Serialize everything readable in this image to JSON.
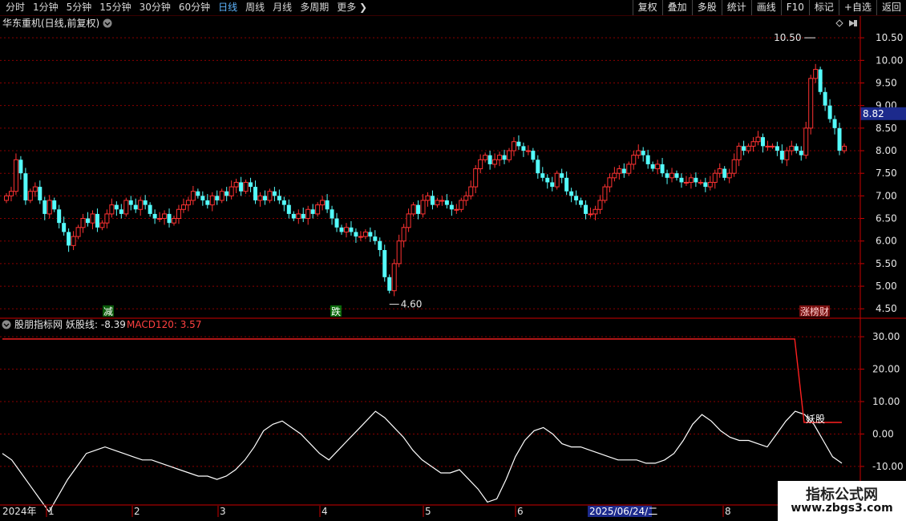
{
  "toolbar": {
    "periods": [
      "分时",
      "1分钟",
      "5分钟",
      "15分钟",
      "30分钟",
      "60分钟",
      "日线",
      "周线",
      "月线",
      "多周期",
      "更多"
    ],
    "active_period": "日线",
    "right_buttons": [
      "复权",
      "叠加",
      "多股",
      "统计",
      "画线",
      "F10",
      "标记",
      "+自选",
      "返回"
    ]
  },
  "colors": {
    "up": "#ff3232",
    "down": "#54fcfc",
    "bg": "#000000",
    "grid": "#8a0000",
    "axis": "#cc0000",
    "price_tag_bg": "#1c2a8c"
  },
  "main": {
    "title": "华东重机(日线,前复权)",
    "price_tag": "8.82",
    "high_label": "10.50",
    "low_label": "4.60",
    "markers": [
      "减",
      "跌",
      "涨榜财"
    ]
  },
  "indicator": {
    "title": "股朋指标网",
    "line1_label": "妖股线: -8.39",
    "line2_label": "MACD120: 3.57",
    "annotation": "妖股"
  },
  "xaxis": {
    "year_label": "2024年",
    "months": [
      "1",
      "2",
      "3",
      "4",
      "5",
      "6",
      "8"
    ],
    "highlight": "2025/06/24/二"
  },
  "watermark": {
    "line1": "指标公式网",
    "line2": "www.zbgs3.com"
  },
  "chart_data": [
    {
      "type": "candlestick",
      "title": "华东重机(日线,前复权)",
      "y_ticks": [
        4.5,
        5.0,
        5.5,
        6.0,
        6.5,
        7.0,
        7.5,
        8.0,
        8.5,
        9.0,
        9.5,
        10.0,
        10.5
      ],
      "ylim": [
        4.38,
        10.68
      ],
      "current_price": 8.82,
      "annotations": [
        {
          "label": "10.50",
          "value": 10.5
        },
        {
          "label": "4.60",
          "value": 4.6
        }
      ],
      "close": [
        7.0,
        7.1,
        7.8,
        7.5,
        6.9,
        7.1,
        7.2,
        6.9,
        6.6,
        6.9,
        6.7,
        6.4,
        6.2,
        5.9,
        6.1,
        6.3,
        6.5,
        6.4,
        6.6,
        6.3,
        6.4,
        6.6,
        6.8,
        6.7,
        6.6,
        6.9,
        6.8,
        6.7,
        6.9,
        6.8,
        6.6,
        6.5,
        6.5,
        6.6,
        6.4,
        6.5,
        6.7,
        6.8,
        6.9,
        7.1,
        7.0,
        6.9,
        6.8,
        7.0,
        6.9,
        7.1,
        7.0,
        7.2,
        7.3,
        7.1,
        7.3,
        7.2,
        6.9,
        7.0,
        6.9,
        7.1,
        7.0,
        6.9,
        6.8,
        6.6,
        6.5,
        6.6,
        6.5,
        6.7,
        6.6,
        6.8,
        6.9,
        6.7,
        6.5,
        6.3,
        6.2,
        6.3,
        6.2,
        6.1,
        6.1,
        6.2,
        6.1,
        6.0,
        5.8,
        5.2,
        4.9,
        5.5,
        6.0,
        6.3,
        6.6,
        6.8,
        6.6,
        6.9,
        7.0,
        6.8,
        6.9,
        6.9,
        6.8,
        6.7,
        6.7,
        6.9,
        7.0,
        7.2,
        7.6,
        7.8,
        7.9,
        7.7,
        7.8,
        7.9,
        7.8,
        8.0,
        8.2,
        8.1,
        8.0,
        8.0,
        7.8,
        7.5,
        7.4,
        7.3,
        7.2,
        7.5,
        7.4,
        7.1,
        7.0,
        6.9,
        6.8,
        6.6,
        6.6,
        6.7,
        6.9,
        7.2,
        7.4,
        7.5,
        7.6,
        7.5,
        7.7,
        7.9,
        8.0,
        7.9,
        7.7,
        7.6,
        7.7,
        7.5,
        7.4,
        7.5,
        7.4,
        7.3,
        7.3,
        7.4,
        7.3,
        7.3,
        7.2,
        7.3,
        7.5,
        7.6,
        7.4,
        7.5,
        7.8,
        8.1,
        8.0,
        8.1,
        8.2,
        8.3,
        8.1,
        8.1,
        8.1,
        8.0,
        7.8,
        8.0,
        8.1,
        8.0,
        7.9,
        8.5,
        9.6,
        9.8,
        9.3,
        9.0,
        8.7,
        8.5,
        8.0,
        8.1
      ],
      "xlabel": "",
      "ylabel": ""
    },
    {
      "type": "line",
      "series": [
        {
          "name": "妖股线",
          "values": [
            -6,
            -8,
            -12,
            -16,
            -20,
            -24,
            -19,
            -14,
            -10,
            -6,
            -5,
            -4,
            -5,
            -6,
            -7,
            -8,
            -8,
            -9,
            -10,
            -11,
            -12,
            -13,
            -13,
            -14,
            -13,
            -11,
            -8,
            -4,
            1,
            3,
            4,
            2,
            0,
            -3,
            -6,
            -8,
            -5,
            -2,
            1,
            4,
            7,
            5,
            2,
            -1,
            -5,
            -8,
            -10,
            -12,
            -12,
            -11,
            -14,
            -17,
            -21,
            -20,
            -14,
            -7,
            -2,
            1,
            2,
            0,
            -3,
            -4,
            -4,
            -5,
            -6,
            -7,
            -8,
            -8,
            -8,
            -9,
            -9,
            -8,
            -6,
            -2,
            3,
            6,
            4,
            1,
            -1,
            -2,
            -2,
            -3,
            -4,
            0,
            4,
            7,
            6,
            3,
            -2,
            -7,
            -9
          ],
          "ylim": [
            -12,
            32
          ]
        },
        {
          "name": "MACD120",
          "values": [
            29.3,
            29.3,
            29.3,
            29.3,
            29.3,
            29.3,
            29.3,
            29.3,
            29.3,
            29.3,
            29.3,
            29.3,
            29.3,
            29.3,
            29.3,
            29.3,
            29.3,
            29.3,
            29.3,
            29.3,
            29.3,
            29.3,
            29.3,
            29.3,
            29.3,
            29.3,
            29.3,
            29.3,
            29.3,
            29.3,
            29.3,
            29.3,
            29.3,
            29.3,
            29.3,
            29.3,
            29.3,
            29.3,
            29.3,
            29.3,
            29.3,
            29.3,
            29.3,
            29.3,
            29.3,
            29.3,
            29.3,
            29.3,
            29.3,
            29.3,
            29.3,
            29.3,
            29.3,
            29.3,
            29.3,
            29.3,
            29.3,
            29.3,
            29.3,
            29.3,
            29.3,
            29.3,
            29.3,
            29.3,
            29.3,
            29.3,
            29.3,
            29.3,
            29.3,
            29.3,
            29.3,
            29.3,
            29.3,
            29.3,
            29.3,
            29.3,
            29.3,
            29.3,
            29.3,
            29.3,
            29.3,
            29.3,
            29.3,
            29.3,
            29.3,
            3.57,
            3.57,
            3.57,
            3.57,
            3.57
          ],
          "ylim": [
            -12,
            32
          ]
        }
      ],
      "y_ticks": [
        -10.0,
        0.0,
        10.0,
        20.0,
        30.0
      ],
      "ylim": [
        -12,
        32
      ],
      "xlabel": "",
      "ylabel": ""
    }
  ]
}
